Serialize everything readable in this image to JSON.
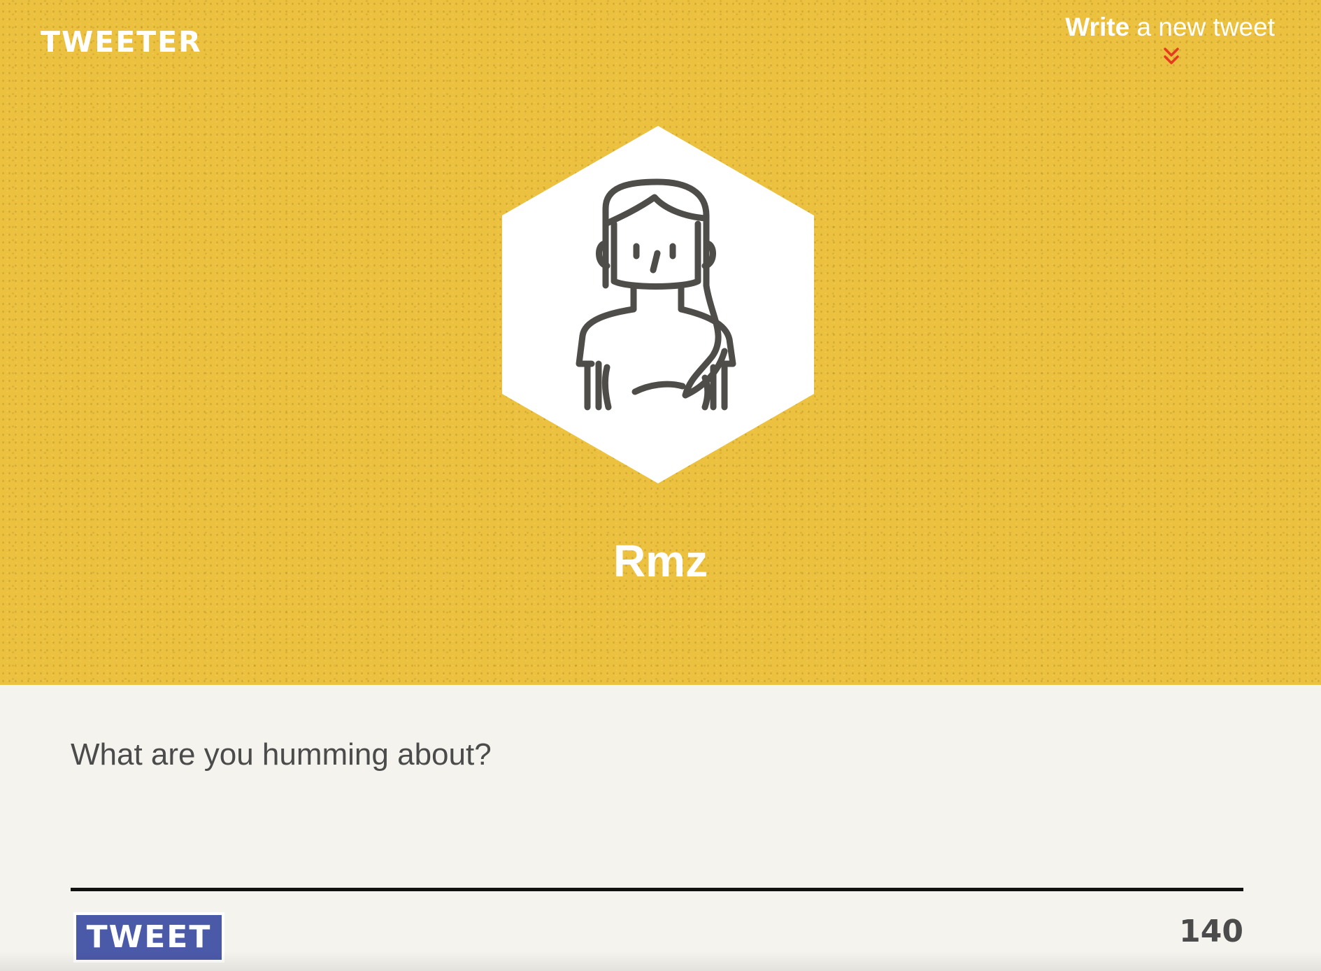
{
  "header": {
    "logo_text": "TWEETER",
    "write_link_bold": "Write",
    "write_link_rest": " a new tweet",
    "write_arrow_icon": "double-chevron-down-icon",
    "arrow_color": "#e63a1e"
  },
  "profile": {
    "avatar_icon": "woman-avatar-icon",
    "username": "Rmz"
  },
  "composer": {
    "placeholder": "What are you humming about?",
    "value": "",
    "tweet_button_label": "TWEET",
    "char_count": "140"
  },
  "colors": {
    "hero_background": "#ebc13f",
    "page_background": "#f4f3ed",
    "button_background": "#4b59a9",
    "text_dark": "#4b4b4b"
  }
}
